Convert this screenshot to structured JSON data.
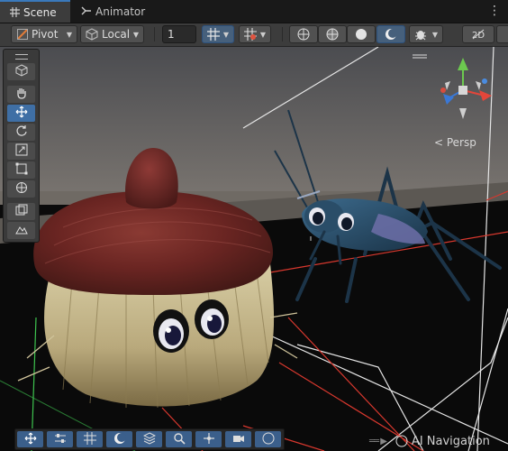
{
  "tabs": [
    {
      "label": "Scene",
      "icon": "grid-icon"
    },
    {
      "label": "Animator",
      "icon": "animator-icon"
    }
  ],
  "toolbar": {
    "pivot_label": "Pivot",
    "local_label": "Local",
    "grid_size_value": "1"
  },
  "viewport": {
    "projection_label": "< Persp",
    "colors": {
      "sky_top": "#4b4c50",
      "floor": "#0a0a0a",
      "grid_red": "#d8382e",
      "grid_white": "#e6e6e6",
      "cap_red": "#6a2522",
      "bristle": "#d4c8a0",
      "cricket": "#2b4e6a"
    }
  },
  "tools_panel": {
    "items": [
      "view-tool",
      "hand-tool",
      "move-tool",
      "rotate-tool",
      "scale-tool",
      "rect-tool",
      "transform-tool",
      "custom-tool",
      "editor-tool"
    ],
    "selected": "move-tool"
  },
  "overlay_bar": {
    "items": [
      "move-overlay",
      "tool-settings",
      "grid-snapping",
      "view-options",
      "layers",
      "search",
      "orientation",
      "camera",
      "navigation"
    ]
  },
  "footer": {
    "ai_navigation_label": "AI Navigation"
  }
}
